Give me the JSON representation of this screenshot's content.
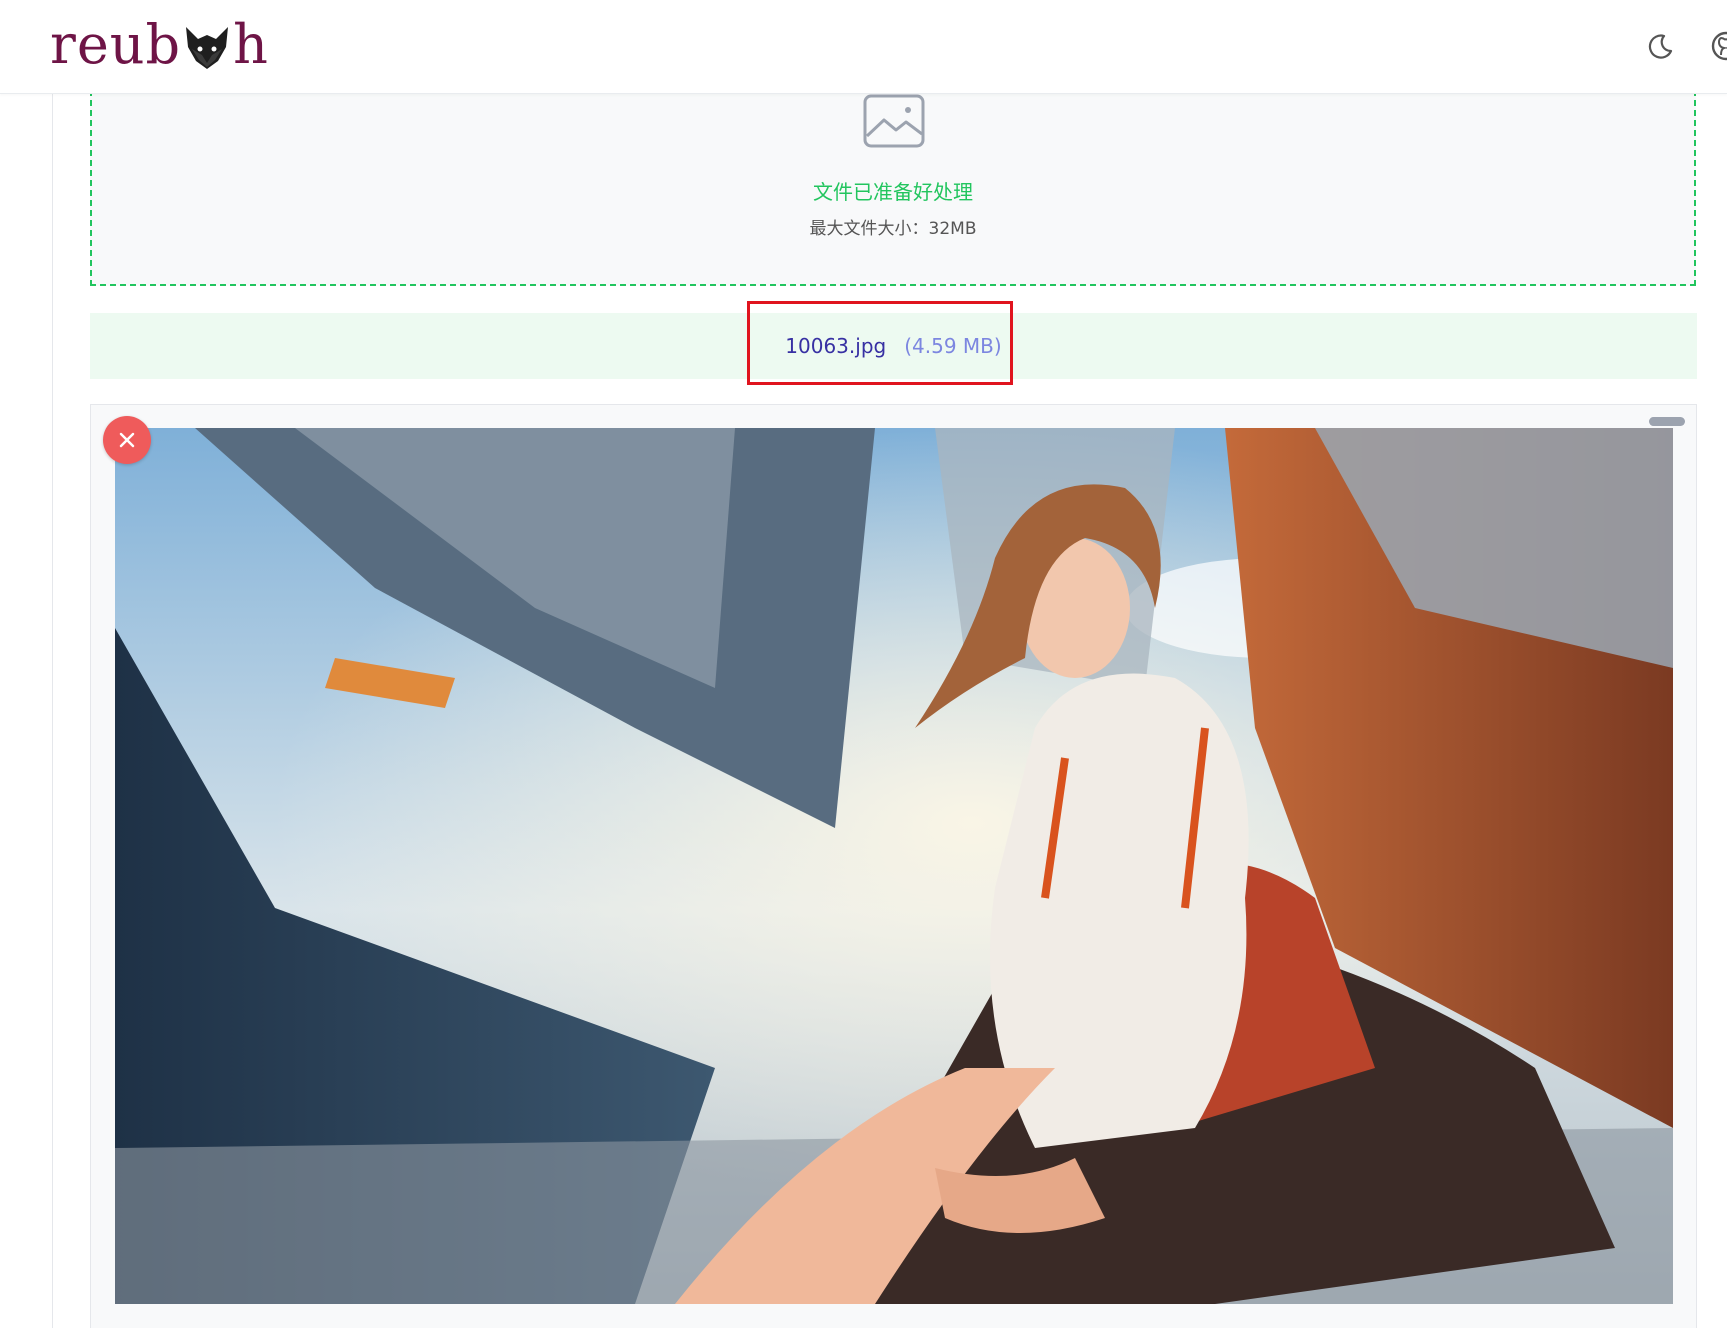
{
  "header": {
    "logo": {
      "part1": "reub",
      "part2": "h"
    },
    "theme_icon": "moon-icon",
    "github_icon": "github-icon"
  },
  "dropzone": {
    "icon": "image-icon",
    "status": "文件已准备好处理",
    "limit": "最大文件大小：32MB"
  },
  "file": {
    "name": "10063.jpg",
    "size": "(4.59 MB)"
  },
  "preview": {
    "remove_icon": "close-icon",
    "handle_icon": "drag-handle"
  },
  "colors": {
    "accent_green": "#22c55e",
    "brand": "#6e1446",
    "file_name": "#3730a3",
    "highlight": "#e0141e",
    "remove": "#ef5b5b"
  }
}
